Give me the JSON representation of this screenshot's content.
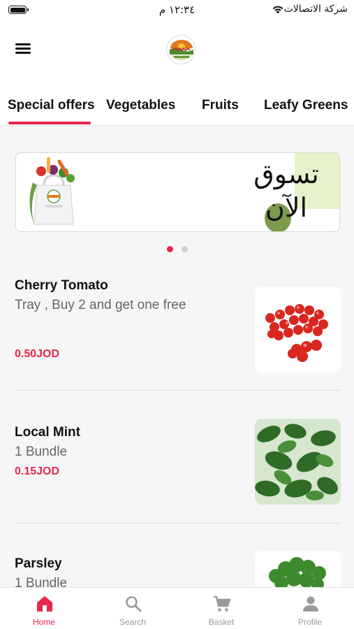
{
  "status_bar": {
    "time": "١٢:٣٤ م",
    "carrier": "شركة الاتصالات"
  },
  "header": {
    "menu_icon": "hamburger-menu-icon",
    "logo": "farm-logo"
  },
  "tabs": [
    {
      "label": "Special offers",
      "active": true
    },
    {
      "label": "Vegetables",
      "active": false
    },
    {
      "label": "Fruits",
      "active": false
    },
    {
      "label": "Leafy Greens",
      "active": false
    }
  ],
  "banner": {
    "headline": "تسوق الآن",
    "slides": 2,
    "active_slide": 1
  },
  "products": [
    {
      "name": "Cherry Tomato",
      "description": "Tray , Buy 2 and get one free",
      "price": "0.50JOD",
      "image": "cherry-tomato-photo"
    },
    {
      "name": "Local Mint",
      "description": "1 Bundle",
      "price": "0.15JOD",
      "image": "mint-photo"
    },
    {
      "name": "Parsley",
      "description": "1 Bundle",
      "price": "",
      "image": "parsley-photo"
    }
  ],
  "bottom_nav": [
    {
      "label": "Home",
      "icon": "home-icon",
      "active": true
    },
    {
      "label": "Search",
      "icon": "search-icon",
      "active": false
    },
    {
      "label": "Basket",
      "icon": "cart-icon",
      "active": false
    },
    {
      "label": "Profile",
      "icon": "profile-icon",
      "active": false
    }
  ],
  "colors": {
    "accent": "#e8274b",
    "inactive": "#9a9a9a",
    "background": "#f6f6f6",
    "banner_green": "#e6f2c9"
  }
}
